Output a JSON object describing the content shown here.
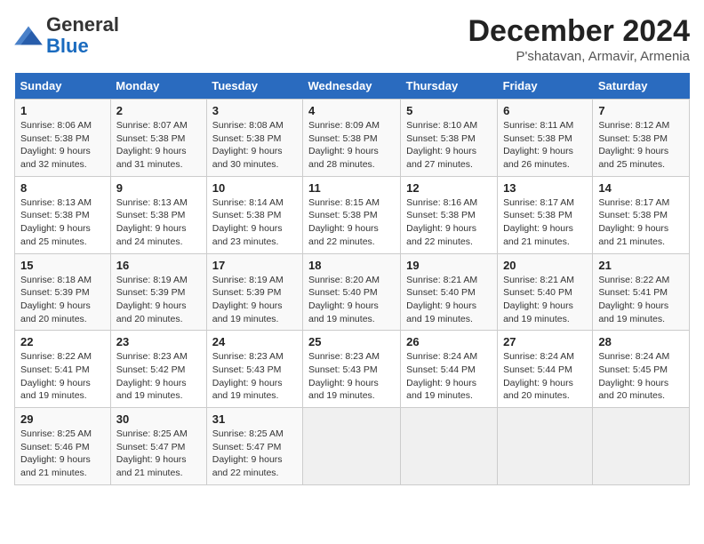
{
  "header": {
    "logo_line1": "General",
    "logo_line2": "Blue",
    "month_title": "December 2024",
    "subtitle": "P'shatavan, Armavir, Armenia"
  },
  "weekdays": [
    "Sunday",
    "Monday",
    "Tuesday",
    "Wednesday",
    "Thursday",
    "Friday",
    "Saturday"
  ],
  "weeks": [
    [
      {
        "day": "1",
        "sunrise": "8:06 AM",
        "sunset": "5:38 PM",
        "daylight": "9 hours and 32 minutes."
      },
      {
        "day": "2",
        "sunrise": "8:07 AM",
        "sunset": "5:38 PM",
        "daylight": "9 hours and 31 minutes."
      },
      {
        "day": "3",
        "sunrise": "8:08 AM",
        "sunset": "5:38 PM",
        "daylight": "9 hours and 30 minutes."
      },
      {
        "day": "4",
        "sunrise": "8:09 AM",
        "sunset": "5:38 PM",
        "daylight": "9 hours and 28 minutes."
      },
      {
        "day": "5",
        "sunrise": "8:10 AM",
        "sunset": "5:38 PM",
        "daylight": "9 hours and 27 minutes."
      },
      {
        "day": "6",
        "sunrise": "8:11 AM",
        "sunset": "5:38 PM",
        "daylight": "9 hours and 26 minutes."
      },
      {
        "day": "7",
        "sunrise": "8:12 AM",
        "sunset": "5:38 PM",
        "daylight": "9 hours and 25 minutes."
      }
    ],
    [
      {
        "day": "8",
        "sunrise": "8:13 AM",
        "sunset": "5:38 PM",
        "daylight": "9 hours and 25 minutes."
      },
      {
        "day": "9",
        "sunrise": "8:13 AM",
        "sunset": "5:38 PM",
        "daylight": "9 hours and 24 minutes."
      },
      {
        "day": "10",
        "sunrise": "8:14 AM",
        "sunset": "5:38 PM",
        "daylight": "9 hours and 23 minutes."
      },
      {
        "day": "11",
        "sunrise": "8:15 AM",
        "sunset": "5:38 PM",
        "daylight": "9 hours and 22 minutes."
      },
      {
        "day": "12",
        "sunrise": "8:16 AM",
        "sunset": "5:38 PM",
        "daylight": "9 hours and 22 minutes."
      },
      {
        "day": "13",
        "sunrise": "8:17 AM",
        "sunset": "5:38 PM",
        "daylight": "9 hours and 21 minutes."
      },
      {
        "day": "14",
        "sunrise": "8:17 AM",
        "sunset": "5:38 PM",
        "daylight": "9 hours and 21 minutes."
      }
    ],
    [
      {
        "day": "15",
        "sunrise": "8:18 AM",
        "sunset": "5:39 PM",
        "daylight": "9 hours and 20 minutes."
      },
      {
        "day": "16",
        "sunrise": "8:19 AM",
        "sunset": "5:39 PM",
        "daylight": "9 hours and 20 minutes."
      },
      {
        "day": "17",
        "sunrise": "8:19 AM",
        "sunset": "5:39 PM",
        "daylight": "9 hours and 19 minutes."
      },
      {
        "day": "18",
        "sunrise": "8:20 AM",
        "sunset": "5:40 PM",
        "daylight": "9 hours and 19 minutes."
      },
      {
        "day": "19",
        "sunrise": "8:21 AM",
        "sunset": "5:40 PM",
        "daylight": "9 hours and 19 minutes."
      },
      {
        "day": "20",
        "sunrise": "8:21 AM",
        "sunset": "5:40 PM",
        "daylight": "9 hours and 19 minutes."
      },
      {
        "day": "21",
        "sunrise": "8:22 AM",
        "sunset": "5:41 PM",
        "daylight": "9 hours and 19 minutes."
      }
    ],
    [
      {
        "day": "22",
        "sunrise": "8:22 AM",
        "sunset": "5:41 PM",
        "daylight": "9 hours and 19 minutes."
      },
      {
        "day": "23",
        "sunrise": "8:23 AM",
        "sunset": "5:42 PM",
        "daylight": "9 hours and 19 minutes."
      },
      {
        "day": "24",
        "sunrise": "8:23 AM",
        "sunset": "5:43 PM",
        "daylight": "9 hours and 19 minutes."
      },
      {
        "day": "25",
        "sunrise": "8:23 AM",
        "sunset": "5:43 PM",
        "daylight": "9 hours and 19 minutes."
      },
      {
        "day": "26",
        "sunrise": "8:24 AM",
        "sunset": "5:44 PM",
        "daylight": "9 hours and 19 minutes."
      },
      {
        "day": "27",
        "sunrise": "8:24 AM",
        "sunset": "5:44 PM",
        "daylight": "9 hours and 20 minutes."
      },
      {
        "day": "28",
        "sunrise": "8:24 AM",
        "sunset": "5:45 PM",
        "daylight": "9 hours and 20 minutes."
      }
    ],
    [
      {
        "day": "29",
        "sunrise": "8:25 AM",
        "sunset": "5:46 PM",
        "daylight": "9 hours and 21 minutes."
      },
      {
        "day": "30",
        "sunrise": "8:25 AM",
        "sunset": "5:47 PM",
        "daylight": "9 hours and 21 minutes."
      },
      {
        "day": "31",
        "sunrise": "8:25 AM",
        "sunset": "5:47 PM",
        "daylight": "9 hours and 22 minutes."
      },
      null,
      null,
      null,
      null
    ]
  ]
}
